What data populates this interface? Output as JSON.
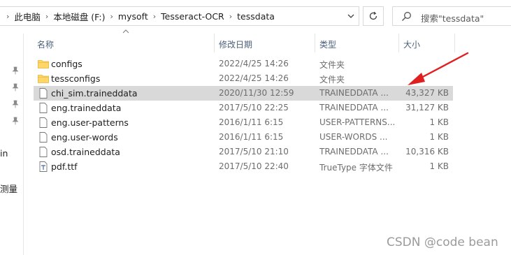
{
  "address_bar": {
    "crumbs": [
      "此电脑",
      "本地磁盘 (F:)",
      "mysoft",
      "Tesseract-OCR",
      "tessdata"
    ]
  },
  "search": {
    "placeholder": "搜索\"tessdata\""
  },
  "nav": {
    "labels": [
      "in",
      "测量"
    ]
  },
  "columns": {
    "name": "名称",
    "date": "修改日期",
    "type": "类型",
    "size": "大小"
  },
  "files": [
    {
      "name": "configs",
      "date": "2022/4/25 14:26",
      "type": "文件夹",
      "size": "",
      "icon": "folder-icon"
    },
    {
      "name": "tessconfigs",
      "date": "2022/4/25 14:26",
      "type": "文件夹",
      "size": "",
      "icon": "folder-icon"
    },
    {
      "name": "chi_sim.traineddata",
      "date": "2020/11/30 12:59",
      "type": "TRAINEDDATA ...",
      "size": "43,327 KB",
      "icon": "file-icon",
      "selected": true
    },
    {
      "name": "eng.traineddata",
      "date": "2017/5/10 22:25",
      "type": "TRAINEDDATA ...",
      "size": "31,127 KB",
      "icon": "file-icon"
    },
    {
      "name": "eng.user-patterns",
      "date": "2016/1/11 6:15",
      "type": "USER-PATTERNS...",
      "size": "1 KB",
      "icon": "file-icon"
    },
    {
      "name": "eng.user-words",
      "date": "2016/1/11 6:15",
      "type": "USER-WORDS ...",
      "size": "1 KB",
      "icon": "file-icon"
    },
    {
      "name": "osd.traineddata",
      "date": "2017/5/10 21:10",
      "type": "TRAINEDDATA ...",
      "size": "10,316 KB",
      "icon": "file-icon"
    },
    {
      "name": "pdf.ttf",
      "date": "2017/5/10 22:40",
      "type": "TrueType 字体文件",
      "size": "1 KB",
      "icon": "font-file-icon"
    }
  ],
  "watermark": "CSDN @code bean",
  "colors": {
    "selection": "#d9d9d9",
    "header_text": "#4c607a",
    "folder": "#ffd667",
    "arrow": "#e02020"
  }
}
